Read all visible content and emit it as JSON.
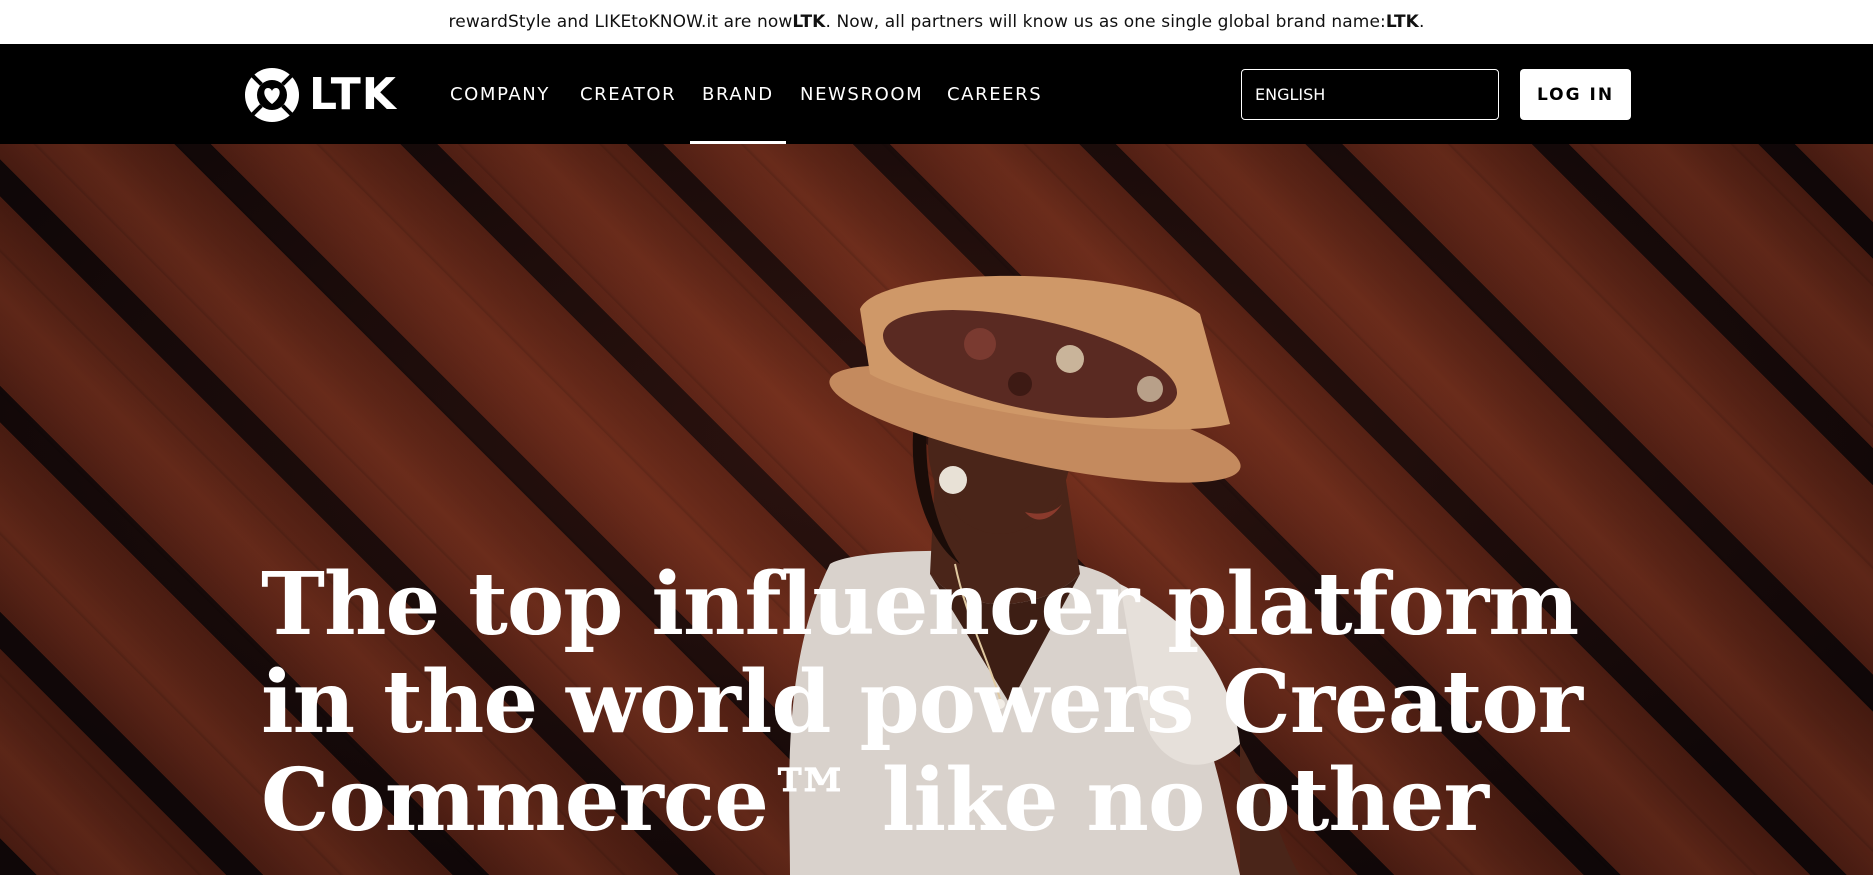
{
  "announcement": {
    "before": "rewardStyle and LIKEtoKNOW.it are now ",
    "brand1": "LTK",
    "middle": ". Now, all partners will know us as one single global brand name: ",
    "brand2": "LTK",
    "end": "."
  },
  "logo": {
    "text": "LTK",
    "icon": "heart-in-circle-logo"
  },
  "nav": {
    "items": [
      {
        "label": "COMPANY"
      },
      {
        "label": "CREATOR"
      },
      {
        "label": "BRAND",
        "active": true
      },
      {
        "label": "NEWSROOM"
      },
      {
        "label": "CAREERS"
      }
    ]
  },
  "language": {
    "value": "ENGLISH"
  },
  "login": {
    "label": "LOG IN"
  },
  "hero": {
    "headline": "The top influencer platform in the world powers Creator Commerce™ like no other"
  },
  "colors": {
    "nav_bg": "#000000",
    "announce_bg": "#ffffff",
    "hero_wood": "#6f2c1c",
    "text_light": "#ffffff"
  }
}
